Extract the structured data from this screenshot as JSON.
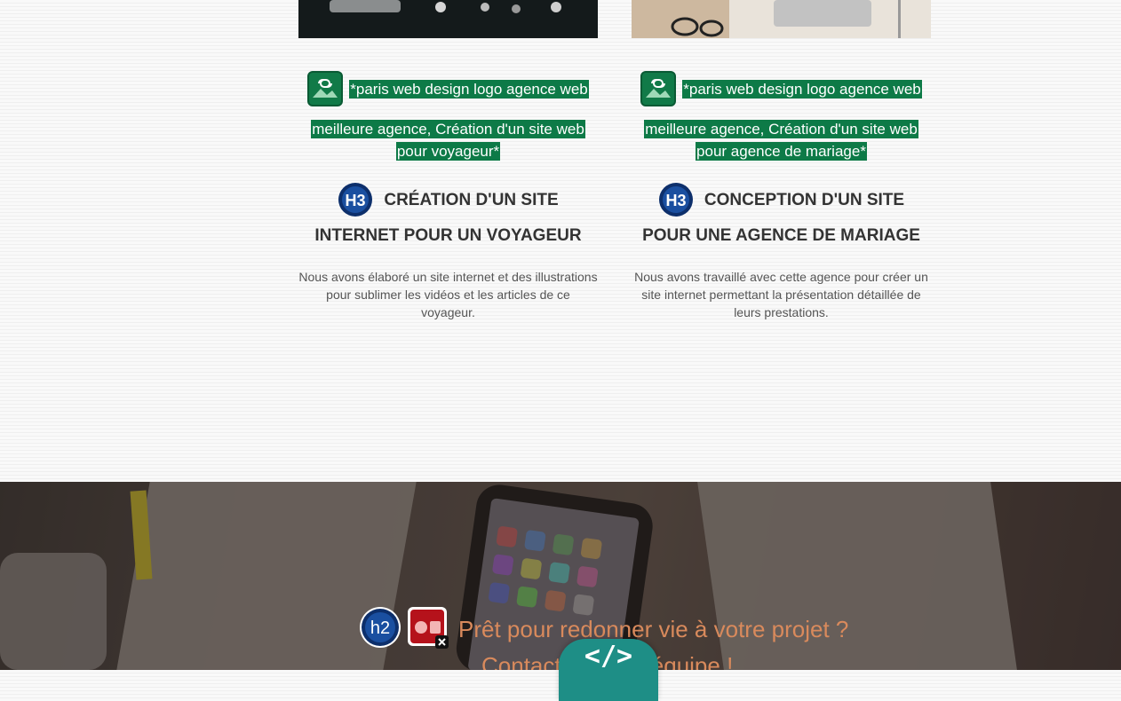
{
  "projects": [
    {
      "image_alt_line1": "*paris web design logo agence web",
      "image_alt_line2": "meilleure agence, Création d'un site web pour voyageur*",
      "heading_tag": "h3",
      "title": "Création d'un site internet pour un voyageur",
      "description": "Nous avons élaboré un site internet et des illustrations pour sublimer les vidéos et les articles de ce voyageur."
    },
    {
      "image_alt_line1": "*paris web design logo agence web",
      "image_alt_line2": "meilleure agence, Création d'un site web pour agence de mariage*",
      "heading_tag": "h3",
      "title": "Conception d'un site pour une agence de mariage",
      "description": "Nous avons travaillé avec cette agence pour créer un site internet permettant la présentation détaillée de leurs prestations."
    }
  ],
  "cta": {
    "heading_tag": "h2",
    "line1": "Prêt pour redonner vie à votre projet ?",
    "line2": "Contactez notre équipe !"
  },
  "code_badge": "</>",
  "colors": {
    "alt_highlight": "#0d7a47",
    "cta_text": "#d98a5c",
    "code_badge": "#1e8e86",
    "heading_badge": "#1a4fa0"
  },
  "icons": [
    "image-link-icon",
    "h3-badge-icon",
    "h2-badge-icon",
    "media-placeholder-icon",
    "code-view-icon"
  ]
}
